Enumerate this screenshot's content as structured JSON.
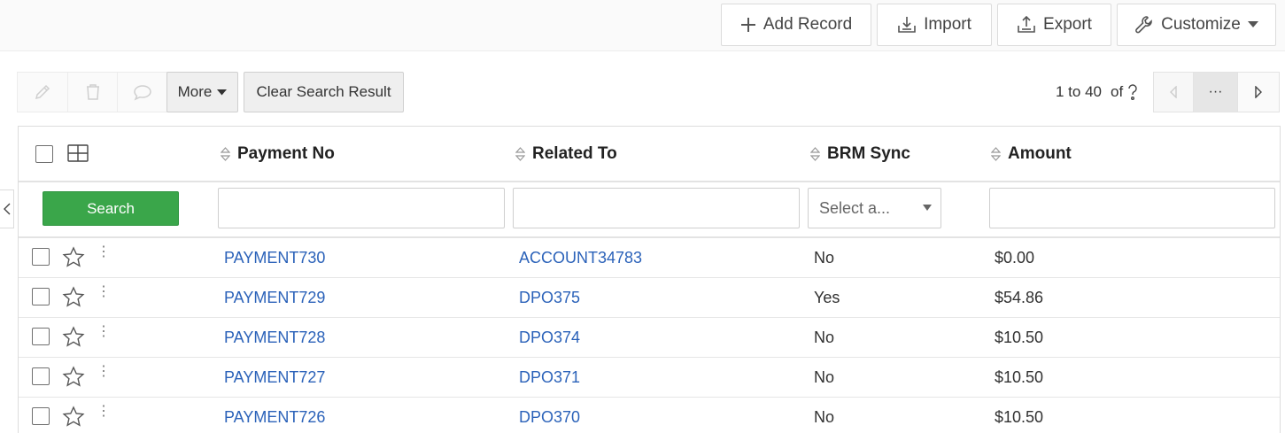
{
  "topbar": {
    "add_record": "Add Record",
    "import": "Import",
    "export": "Export",
    "customize": "Customize"
  },
  "toolbar": {
    "more": "More",
    "clear_search": "Clear Search Result"
  },
  "pagination": {
    "range": "1 to 40",
    "of": "of",
    "dots": "···"
  },
  "table": {
    "columns": [
      "Payment No",
      "Related To",
      "BRM Sync",
      "Amount"
    ],
    "search_label": "Search",
    "select_placeholder": "Select a...",
    "rows": [
      {
        "payment_no": "PAYMENT730",
        "related_to": "ACCOUNT34783",
        "brm_sync": "No",
        "amount": "$0.00"
      },
      {
        "payment_no": "PAYMENT729",
        "related_to": "DPO375",
        "brm_sync": "Yes",
        "amount": "$54.86"
      },
      {
        "payment_no": "PAYMENT728",
        "related_to": "DPO374",
        "brm_sync": "No",
        "amount": "$10.50"
      },
      {
        "payment_no": "PAYMENT727",
        "related_to": "DPO371",
        "brm_sync": "No",
        "amount": "$10.50"
      },
      {
        "payment_no": "PAYMENT726",
        "related_to": "DPO370",
        "brm_sync": "No",
        "amount": "$10.50"
      }
    ]
  },
  "colors": {
    "link": "#2b62b9",
    "search_button": "#3aa64a"
  }
}
